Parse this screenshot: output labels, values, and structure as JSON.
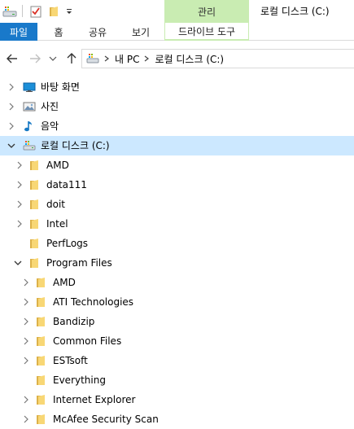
{
  "titlebar": {
    "manage_tab": "관리",
    "window_title": "로컬 디스크 (C:)"
  },
  "ribbon": {
    "tabs": [
      "파일",
      "홈",
      "공유",
      "보기"
    ],
    "drive_tools_tab": "드라이브 도구"
  },
  "address": {
    "crumbs": [
      "내 PC",
      "로컬 디스크 (C:)"
    ]
  },
  "tree": {
    "items": [
      {
        "label": "바탕 화면",
        "icon": "desktop-icon"
      },
      {
        "label": "사진",
        "icon": "pictures-icon"
      },
      {
        "label": "음악",
        "icon": "music-icon"
      },
      {
        "label": "로컬 디스크 (C:)",
        "icon": "drive-icon"
      },
      {
        "label": "AMD",
        "icon": "folder-icon"
      },
      {
        "label": "data111",
        "icon": "folder-icon"
      },
      {
        "label": "doit",
        "icon": "folder-icon"
      },
      {
        "label": "Intel",
        "icon": "folder-icon"
      },
      {
        "label": "PerfLogs",
        "icon": "folder-icon"
      },
      {
        "label": "Program Files",
        "icon": "folder-icon"
      },
      {
        "label": "AMD",
        "icon": "folder-icon"
      },
      {
        "label": "ATI Technologies",
        "icon": "folder-icon"
      },
      {
        "label": "Bandizip",
        "icon": "folder-icon"
      },
      {
        "label": "Common Files",
        "icon": "folder-icon"
      },
      {
        "label": "ESTsoft",
        "icon": "folder-icon"
      },
      {
        "label": "Everything",
        "icon": "folder-icon"
      },
      {
        "label": "Internet Explorer",
        "icon": "folder-icon"
      },
      {
        "label": "McAfee Security Scan",
        "icon": "folder-icon"
      }
    ]
  }
}
